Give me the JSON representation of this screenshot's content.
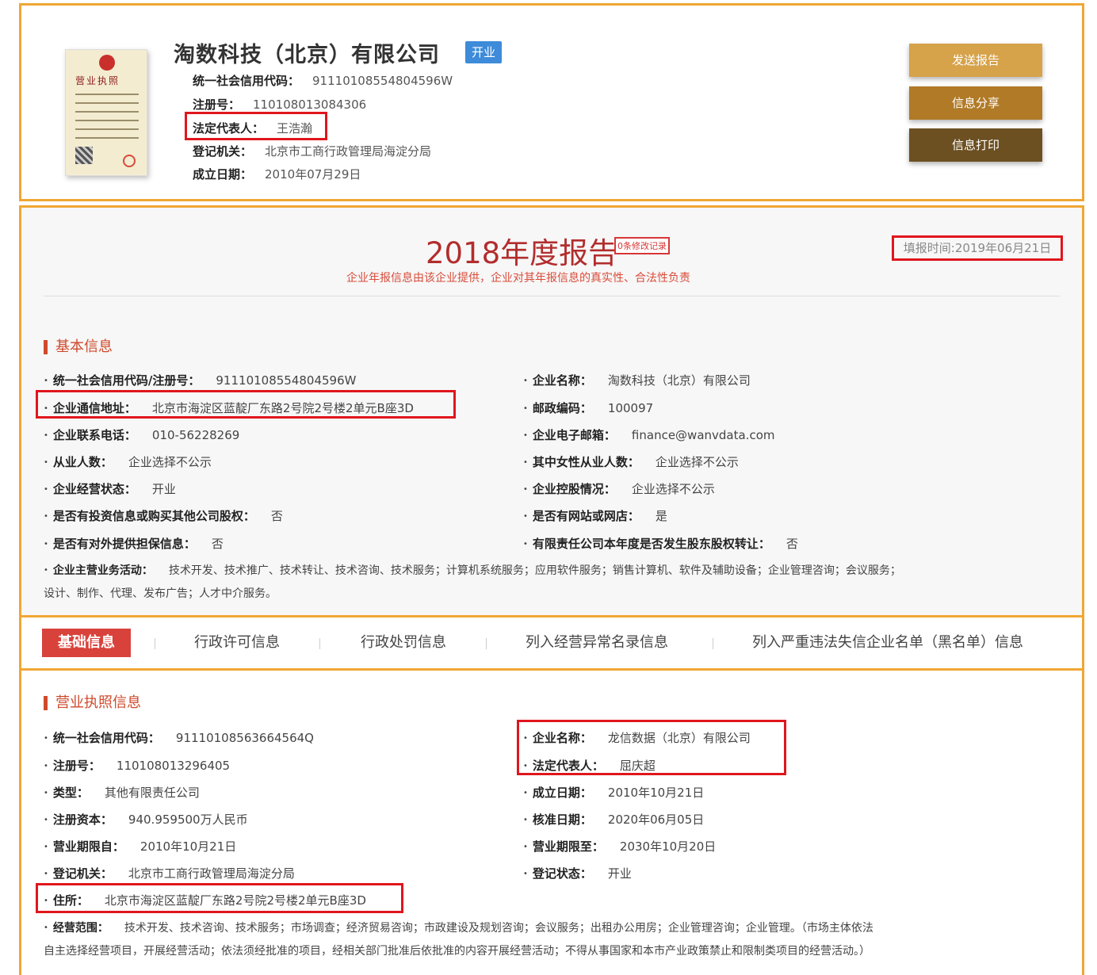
{
  "header": {
    "license_image_title": "营业执照",
    "company_name": "淘数科技（北京）有限公司",
    "status": "开业",
    "fields": [
      {
        "label": "统一社会信用代码：",
        "value": "91110108554804596W"
      },
      {
        "label": "注册号：",
        "value": "110108013084306"
      },
      {
        "label": "法定代表人：",
        "value": "王浩瀚"
      },
      {
        "label": "登记机关：",
        "value": "北京市工商行政管理局海淀分局"
      },
      {
        "label": "成立日期：",
        "value": "2010年07月29日"
      }
    ],
    "buttons": {
      "send": "发送报告",
      "share": "信息分享",
      "print": "信息打印"
    }
  },
  "report": {
    "title": "2018年度报告",
    "modify_badge": "0条修改记录",
    "fill_date": "填报时间:2019年06月21日",
    "subtitle": "企业年报信息由该企业提供，企业对其年报信息的真实性、合法性负责",
    "basic_heading": "基本信息",
    "left": [
      {
        "label": "统一社会信用代码/注册号：",
        "value": "91110108554804596W"
      },
      {
        "label": "企业通信地址：",
        "value": "北京市海淀区蓝靛厂东路2号院2号楼2单元B座3D"
      },
      {
        "label": "企业联系电话：",
        "value": "010-56228269"
      },
      {
        "label": "从业人数：",
        "value": "企业选择不公示"
      },
      {
        "label": "企业经营状态：",
        "value": "开业"
      },
      {
        "label": "是否有投资信息或购买其他公司股权：",
        "value": "否"
      },
      {
        "label": "是否有对外提供担保信息：",
        "value": "否"
      }
    ],
    "right": [
      {
        "label": "企业名称：",
        "value": "淘数科技（北京）有限公司"
      },
      {
        "label": "邮政编码：",
        "value": "100097"
      },
      {
        "label": "企业电子邮箱：",
        "value": "finance@wanvdata.com"
      },
      {
        "label": "其中女性从业人数：",
        "value": "企业选择不公示"
      },
      {
        "label": "企业控股情况：",
        "value": "企业选择不公示"
      },
      {
        "label": "是否有网站或网店：",
        "value": "是"
      },
      {
        "label": "有限责任公司本年度是否发生股东股权转让：",
        "value": "否"
      }
    ],
    "business_label": "企业主营业务活动：",
    "business_line1": "技术开发、技术推广、技术转让、技术咨询、技术服务；计算机系统服务；应用软件服务；销售计算机、软件及辅助设备；企业管理咨询；会议服务；",
    "business_line2": "设计、制作、代理、发布广告；人才中介服务。"
  },
  "tabs": [
    "基础信息",
    "行政许可信息",
    "行政处罚信息",
    "列入经营异常名录信息",
    "列入严重违法失信企业名单（黑名单）信息"
  ],
  "license": {
    "heading": "营业执照信息",
    "left": [
      {
        "label": "统一社会信用代码：",
        "value": "91110108563664564Q"
      },
      {
        "label": "注册号：",
        "value": "110108013296405"
      },
      {
        "label": "类型：",
        "value": "其他有限责任公司"
      },
      {
        "label": "注册资本：",
        "value": "940.959500万人民币"
      },
      {
        "label": "营业期限自：",
        "value": "2010年10月21日"
      },
      {
        "label": "登记机关：",
        "value": "北京市工商行政管理局海淀分局"
      },
      {
        "label": "住所：",
        "value": "北京市海淀区蓝靛厂东路2号院2号楼2单元B座3D"
      }
    ],
    "right": [
      {
        "label": "企业名称：",
        "value": "龙信数据（北京）有限公司"
      },
      {
        "label": "法定代表人：",
        "value": "屈庆超"
      },
      {
        "label": "成立日期：",
        "value": "2010年10月21日"
      },
      {
        "label": "核准日期：",
        "value": "2020年06月05日"
      },
      {
        "label": "营业期限至：",
        "value": "2030年10月20日"
      },
      {
        "label": "登记状态：",
        "value": "开业"
      }
    ],
    "scope_label": "经营范围：",
    "scope_line1": "技术开发、技术咨询、技术服务；市场调查；经济贸易咨询；市政建设及规划咨询；会议服务；出租办公用房；企业管理咨询；企业管理。（市场主体依法",
    "scope_line2": "自主选择经营项目，开展经营活动；依法须经批准的项目，经相关部门批准后依批准的内容开展经营活动；不得从事国家和本市产业政策禁止和限制类项目的经营活动。）"
  },
  "colors": {
    "border": "#f0a734",
    "accent_red": "#cf4a2c",
    "highlight": "#e0161d",
    "badge_blue": "#3d8bd9"
  }
}
